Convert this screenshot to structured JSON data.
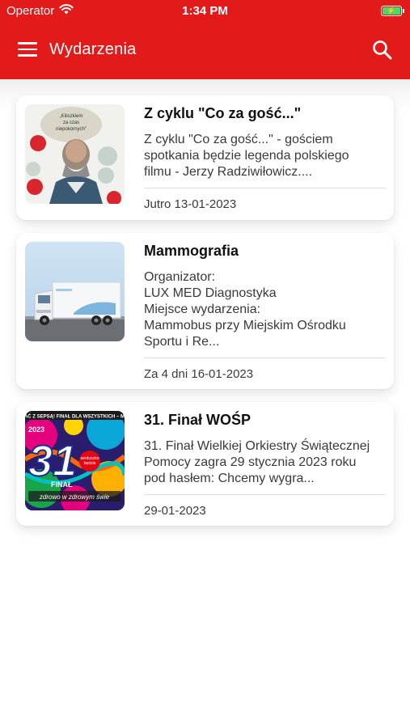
{
  "status_bar": {
    "carrier": "Operator",
    "time": "1:34 PM",
    "wifi_icon": "wifi-icon",
    "battery_icon": "battery-charging-icon"
  },
  "app_bar": {
    "title": "Wydarzenia",
    "menu_icon": "hamburger-menu-icon",
    "search_icon": "search-icon",
    "color": "#e21a1a"
  },
  "events": [
    {
      "title": "Z cyklu \"Co za gość...\"",
      "description": "Z cyklu \"Co za gość...\" - gościem\nspotkania będzie legenda polskiego\nfilmu - Jerzy Radziwiłowicz....",
      "date": "Jutro 13-01-2023",
      "thumb_text": "„Kiliszkiem\nza czas\nniepokornych”"
    },
    {
      "title": "Mammografia",
      "description": "Organizator:\nLUX MED Diagnostyka\nMiejsce wydarzenia:\nMammobus przy Miejskim Ośrodku\nSportu i Re...",
      "date": "Za 4 dni 16-01-2023"
    },
    {
      "title": "31. Finał WOŚP",
      "description": "31. Finał Wielkiej Orkiestry Świątecznej\nPomocy zagra 29 stycznia 2023 roku\npod hasłem: Chcemy wygra...",
      "date": "29-01-2023",
      "thumb_banner": "ĆAĆ Z SEPSĄ! FINAŁ DLA WSZYSTKICH – MA",
      "thumb_year": "2023",
      "thumb_number": "31",
      "thumb_final": "FINAŁ",
      "thumb_slogan": "zdrowo w zdrowym świe"
    }
  ]
}
